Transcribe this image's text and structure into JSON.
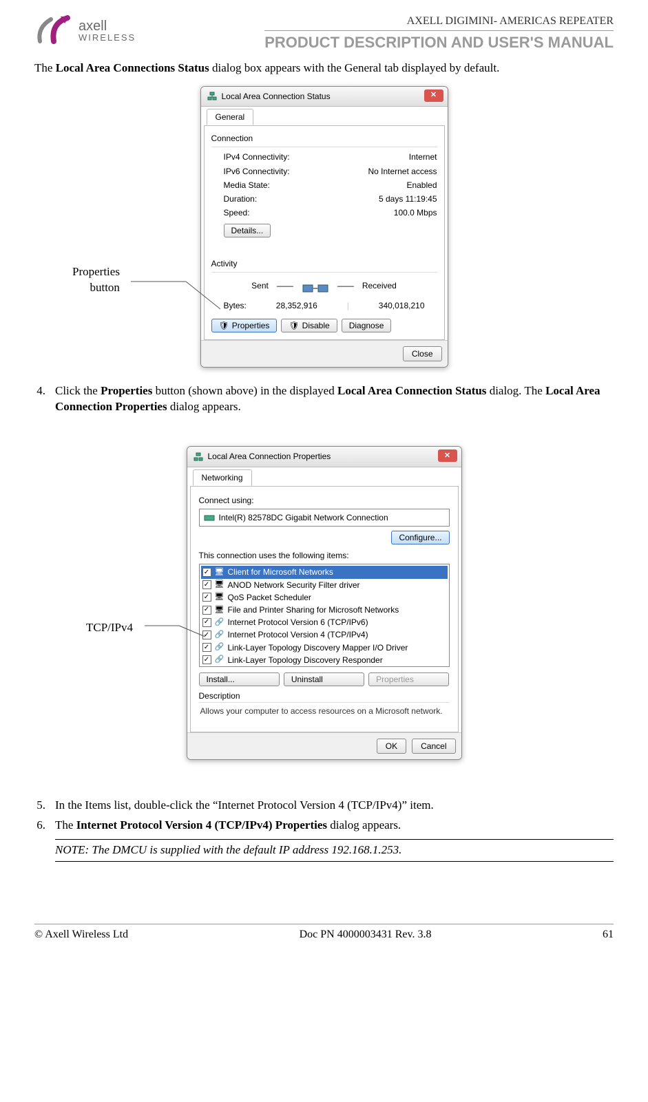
{
  "header": {
    "brand_top": "axell",
    "brand_bottom": "WIRELESS",
    "title_small": "AXELL DIGIMINI- AMERICAS REPEATER",
    "title_big": "PRODUCT DESCRIPTION AND USER'S MANUAL"
  },
  "intro": {
    "pre": "The ",
    "bold": "Local Area Connections Status",
    "post": " dialog box appears with the General tab displayed by default."
  },
  "callout1": {
    "line1": "Properties",
    "line2": "button"
  },
  "dialog1": {
    "title": "Local Area Connection Status",
    "tab": "General",
    "grp_conn": "Connection",
    "rows": [
      {
        "k": "IPv4 Connectivity:",
        "v": "Internet"
      },
      {
        "k": "IPv6 Connectivity:",
        "v": "No Internet access"
      },
      {
        "k": "Media State:",
        "v": "Enabled"
      },
      {
        "k": "Duration:",
        "v": "5 days 11:19:45"
      },
      {
        "k": "Speed:",
        "v": "100.0 Mbps"
      }
    ],
    "details": "Details...",
    "grp_act": "Activity",
    "sent": "Sent",
    "received": "Received",
    "bytes_lbl": "Bytes:",
    "bytes_sent": "28,352,916",
    "bytes_recv": "340,018,210",
    "btn_props": "Properties",
    "btn_disable": "Disable",
    "btn_diag": "Diagnose",
    "btn_close": "Close"
  },
  "step4": {
    "num": "4.",
    "t1": "Click the ",
    "b1": "Properties",
    "t2": " button (shown above) in the displayed ",
    "b2": "Local Area Connection Status",
    "t3": " dialog. The ",
    "b3": "Local Area Connection Properties",
    "t4": " dialog appears."
  },
  "callout2": "TCP/IPv4",
  "dialog2": {
    "title": "Local Area Connection Properties",
    "tab": "Networking",
    "connect_using": "Connect using:",
    "adapter": "Intel(R) 82578DC Gigabit Network Connection",
    "configure": "Configure...",
    "items_label": "This connection uses the following items:",
    "items": [
      "Client for Microsoft Networks",
      "ANOD Network Security Filter driver",
      "QoS Packet Scheduler",
      "File and Printer Sharing for Microsoft Networks",
      "Internet Protocol Version 6 (TCP/IPv6)",
      "Internet Protocol Version 4 (TCP/IPv4)",
      "Link-Layer Topology Discovery Mapper I/O Driver",
      "Link-Layer Topology Discovery Responder"
    ],
    "install": "Install...",
    "uninstall": "Uninstall",
    "properties": "Properties",
    "desc_lbl": "Description",
    "desc_txt": "Allows your computer to access resources on a Microsoft network.",
    "ok": "OK",
    "cancel": "Cancel"
  },
  "step5": {
    "num": "5.",
    "text": "In the Items list, double-click the “Internet Protocol Version 4 (TCP/IPv4)” item."
  },
  "step6": {
    "num": "6.",
    "t1": "The ",
    "b1": "Internet Protocol Version 4 (TCP/IPv4) Properties",
    "t2": " dialog appears."
  },
  "note": "NOTE: The DMCU is supplied with the default IP address 192.168.1.253.",
  "footer": {
    "left": "© Axell Wireless Ltd",
    "center": "Doc PN 4000003431 Rev. 3.8",
    "right": "61"
  }
}
